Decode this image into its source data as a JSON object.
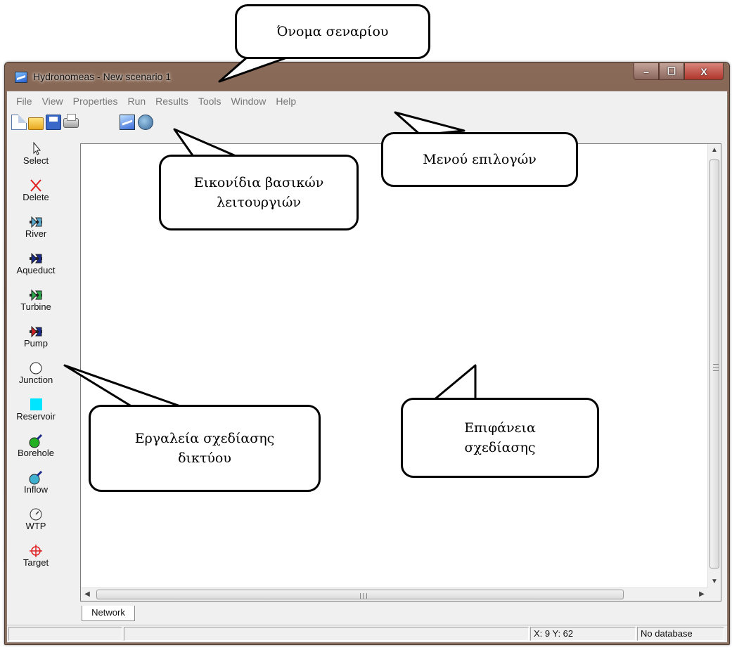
{
  "window": {
    "title": "Hydronomeas - New scenario 1",
    "buttons": {
      "minimize": "–",
      "maximize": "☐",
      "close": "X"
    }
  },
  "menu": [
    "File",
    "View",
    "Properties",
    "Run",
    "Results",
    "Tools",
    "Window",
    "Help"
  ],
  "toolbar": {
    "icons": [
      "new-file-icon",
      "open-folder-icon",
      "save-icon",
      "print-icon",
      "hydronomeas-icon",
      "brain-icon"
    ]
  },
  "tools": [
    {
      "label": "Select",
      "icon": "cursor-arrow-icon"
    },
    {
      "label": "Delete",
      "icon": "red-x-icon"
    },
    {
      "label": "River",
      "icon": "river-link-icon",
      "color": "#5aaad0"
    },
    {
      "label": "Aqueduct",
      "icon": "aqueduct-link-icon",
      "color": "#1a2a8a"
    },
    {
      "label": "Turbine",
      "icon": "turbine-link-icon",
      "color": "#2aa84a"
    },
    {
      "label": "Pump",
      "icon": "pump-link-icon",
      "color": "#d02020"
    },
    {
      "label": "Junction",
      "icon": "junction-circle-icon"
    },
    {
      "label": "Reservoir",
      "icon": "reservoir-square-icon",
      "color": "#00e5ff"
    },
    {
      "label": "Borehole",
      "icon": "borehole-icon",
      "color": "#22b022"
    },
    {
      "label": "Inflow",
      "icon": "inflow-icon",
      "color": "#40b0d0"
    },
    {
      "label": "WTP",
      "icon": "wtp-gauge-icon"
    },
    {
      "label": "Target",
      "icon": "target-crosshair-icon",
      "color": "#e02020"
    }
  ],
  "tabs": [
    "Network"
  ],
  "statusbar": {
    "left": "",
    "middle": "",
    "coords": "X: 9 Y: 62",
    "database": "No database"
  },
  "callouts": {
    "scenario_name": "Όνομα σεναρίου",
    "menu_options": "Μενού επιλογών",
    "basic_icons_line1": "Εικονίδια βασικών",
    "basic_icons_line2": "λειτουργιών",
    "network_tools_line1": "Εργαλεία σχεδίασης",
    "network_tools_line2": "δικτύου",
    "drawing_surface_line1": "Επιφάνεια",
    "drawing_surface_line2": "σχεδίασης"
  },
  "colors": {
    "accent_close": "#c8423a",
    "reservoir": "#00e5ff",
    "pump": "#d02020",
    "turbine": "#2aa84a"
  }
}
